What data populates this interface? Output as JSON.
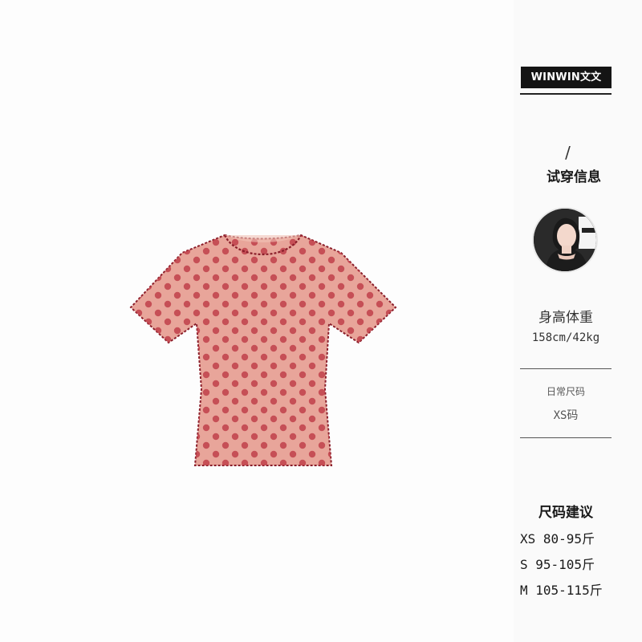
{
  "brand": {
    "name": "WINWIN文文"
  },
  "tryon": {
    "slash": "/",
    "title": "试穿信息",
    "height_weight_label": "身高体重",
    "height_weight_value": "158cm/42kg",
    "daily_size_label": "日常尺码",
    "daily_size_value": "XS码"
  },
  "size_guide": {
    "title": "尺码建议",
    "rows": [
      "XS 80-95斤",
      "S 95-105斤",
      "M 105-115斤"
    ]
  },
  "product": {
    "shirt_color": "#e8a59a",
    "dot_color": "#c0404a",
    "trim_color": "#8b1e2a"
  }
}
